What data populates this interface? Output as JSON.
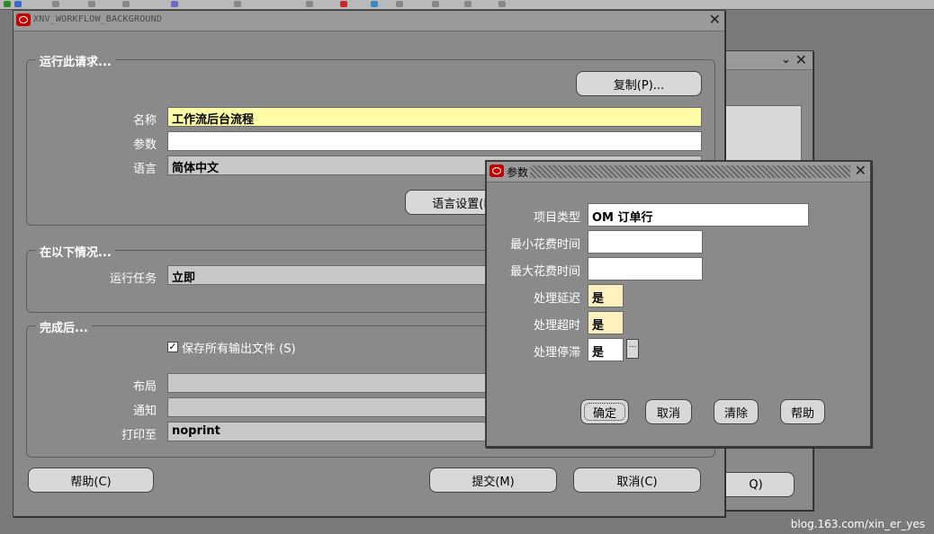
{
  "main_window": {
    "title": "XNV_WORKFLOW_BACKGROUND",
    "run_group": {
      "title": "运行此请求...",
      "copy_button": "复制(P)...",
      "name_label": "名称",
      "name_value": "工作流后台流程",
      "params_label": "参数",
      "params_value": "",
      "language_label": "语言",
      "language_value": "简体中文",
      "language_settings_button": "语言设置(L)"
    },
    "conditions_group": {
      "title": "在以下情况...",
      "run_task_label": "运行任务",
      "run_task_value": "立即"
    },
    "completion_group": {
      "title": "完成后...",
      "save_output_checked": true,
      "save_output_label": "保存所有输出文件 (S)",
      "layout_label": "布局",
      "layout_value": "",
      "notify_label": "通知",
      "notify_value": "",
      "print_to_label": "打印至",
      "print_to_value": "noprint"
    },
    "buttons": {
      "help": "帮助(C)",
      "submit": "提交(M)",
      "cancel": "取消(C)"
    }
  },
  "background_window": {
    "partial_button_label": "Q)"
  },
  "params_dialog": {
    "title": "参数",
    "fields": [
      {
        "label": "项目类型",
        "value": "OM 订单行"
      },
      {
        "label": "最小花费时间",
        "value": ""
      },
      {
        "label": "最大花费时间",
        "value": ""
      },
      {
        "label": "处理延迟",
        "value": "是"
      },
      {
        "label": "处理超时",
        "value": "是"
      },
      {
        "label": "处理停滞",
        "value": "是"
      }
    ],
    "lov_button": "...",
    "buttons": {
      "ok": "确定",
      "cancel": "取消",
      "clear": "清除",
      "help": "帮助"
    }
  },
  "watermark": "blog.163.com/xin_er_yes"
}
